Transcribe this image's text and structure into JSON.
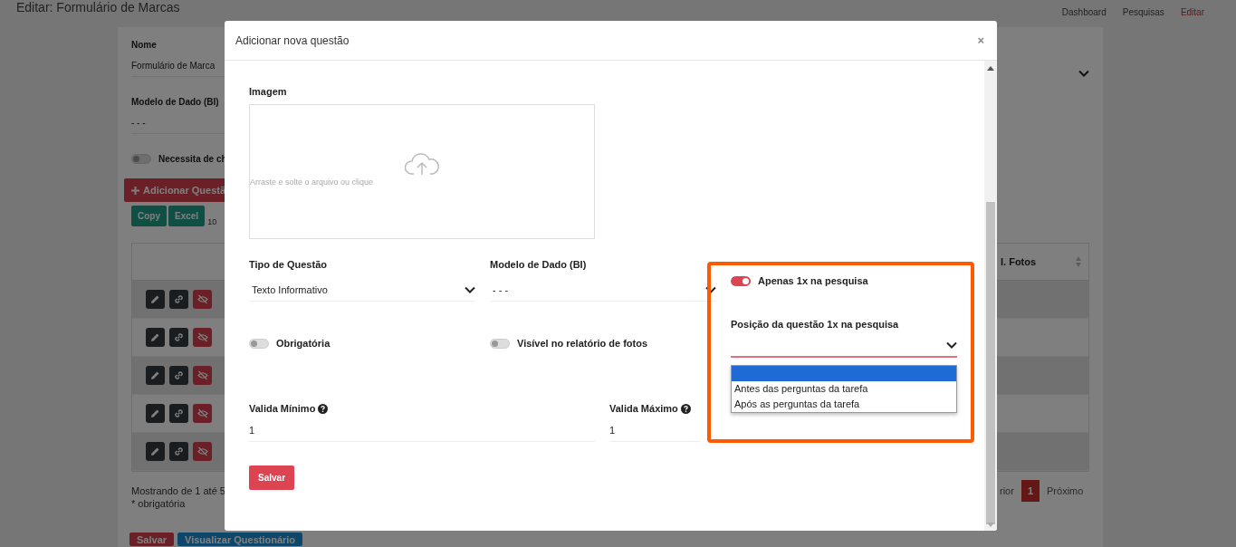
{
  "page": {
    "title": "Editar: Formulário de Marcas",
    "breadcrumb": [
      {
        "label": "Dashboard",
        "selected": false
      },
      {
        "label": "Pesquisas",
        "selected": false
      },
      {
        "label": "Editar",
        "selected": true
      }
    ]
  },
  "form": {
    "fields": [
      {
        "label": "Nome",
        "value": "Formulário de Marca"
      },
      {
        "label": "Modelo de Dado (BI)",
        "value": "- - -"
      }
    ],
    "toggle": {
      "label": "Necessita de ch",
      "on": false
    },
    "add_button": "Adicionar Questã",
    "export_buttons": [
      "Copy",
      "Excel"
    ],
    "page_length": "10"
  },
  "table": {
    "last_column": "l. Fotos",
    "rows": [
      {
        "shaded": true
      },
      {
        "shaded": false
      },
      {
        "shaded": true
      },
      {
        "shaded": false
      },
      {
        "shaded": true
      }
    ]
  },
  "footer": {
    "info": "Mostrando de 1 até 5",
    "note": "* obrigatória",
    "buttons": [
      "Salvar",
      "Visualizar Questionário"
    ]
  },
  "pagination": [
    {
      "label": "rior",
      "selected": false
    },
    {
      "label": "1",
      "selected": true
    },
    {
      "label": "Próximo",
      "selected": false
    }
  ],
  "modal": {
    "title": "Adicionar nova questão",
    "close": "×",
    "image": {
      "label": "Imagem",
      "hint": "Arraste e solte o arquivo ou clique"
    },
    "selects": [
      {
        "label": "Tipo de Questão",
        "value": "Texto Informativo"
      },
      {
        "label": "Modelo de Dado (BI)",
        "value": "- - -"
      }
    ],
    "toggles": [
      {
        "label": "Obrigatória",
        "on": false
      },
      {
        "label": "Visível no relatório de fotos",
        "on": false
      }
    ],
    "once": {
      "label": "Apenas 1x na pesquisa",
      "on": true
    },
    "position": {
      "label": "Posição da questão 1x na pesquisa",
      "expanded": true,
      "options": [
        {
          "selected": true
        },
        {
          "label": "Antes das perguntas da tarefa",
          "selected": false
        },
        {
          "label": "Após as perguntas da tarefa",
          "selected": false
        }
      ]
    },
    "validation": [
      {
        "label": "Valida Mínimo",
        "value": "1"
      },
      {
        "label": "Valida Máximo",
        "value": "1"
      }
    ],
    "save": "Salvar"
  }
}
